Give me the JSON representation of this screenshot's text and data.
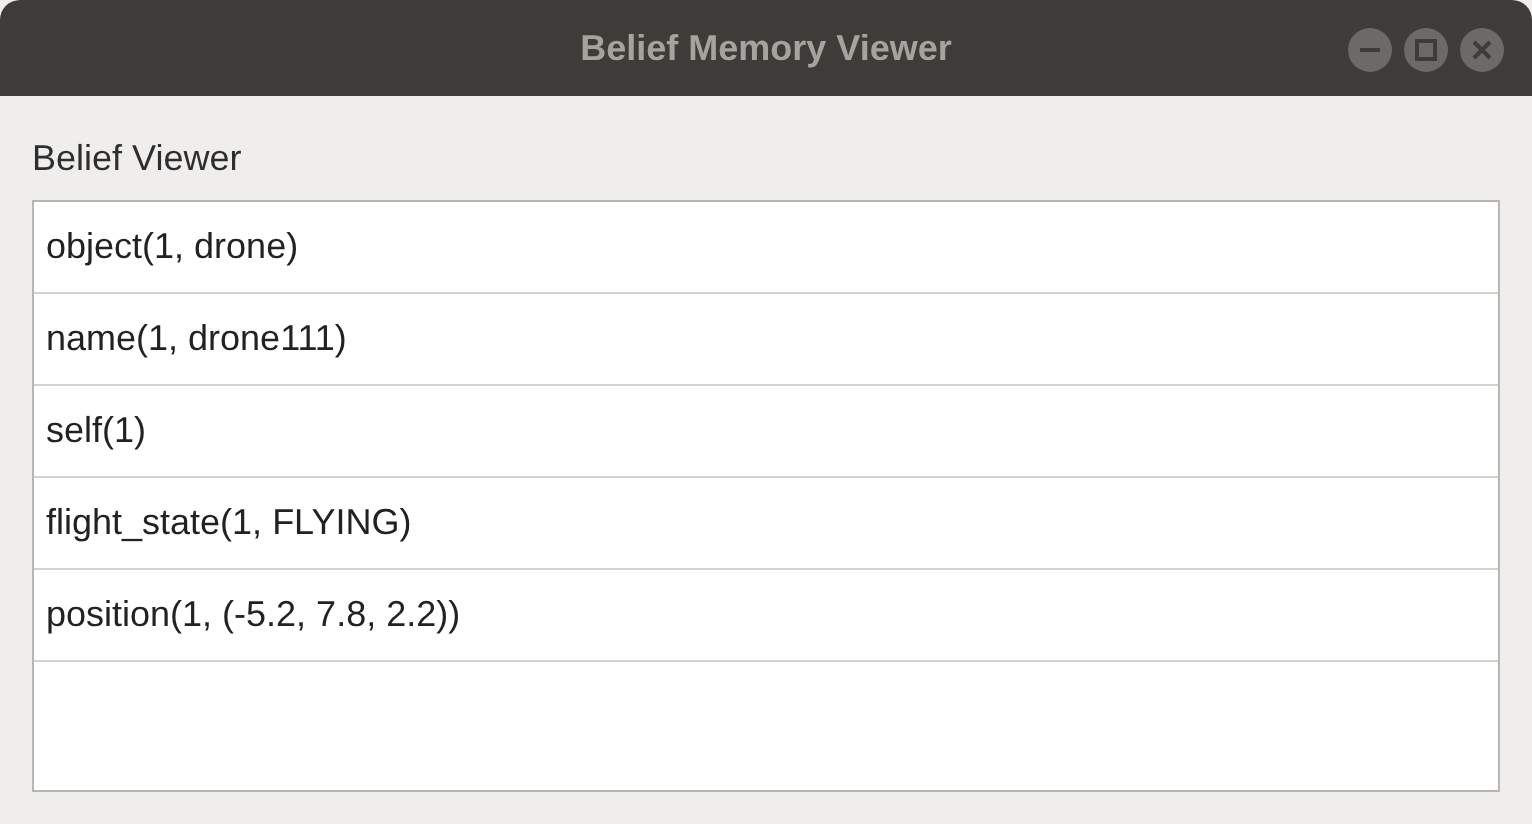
{
  "window": {
    "title": "Belief Memory Viewer"
  },
  "heading": "Belief Viewer",
  "beliefs": [
    "object(1, drone)",
    "name(1, drone111)",
    "self(1)",
    "flight_state(1, FLYING)",
    "position(1, (-5.2, 7.8, 2.2))"
  ]
}
